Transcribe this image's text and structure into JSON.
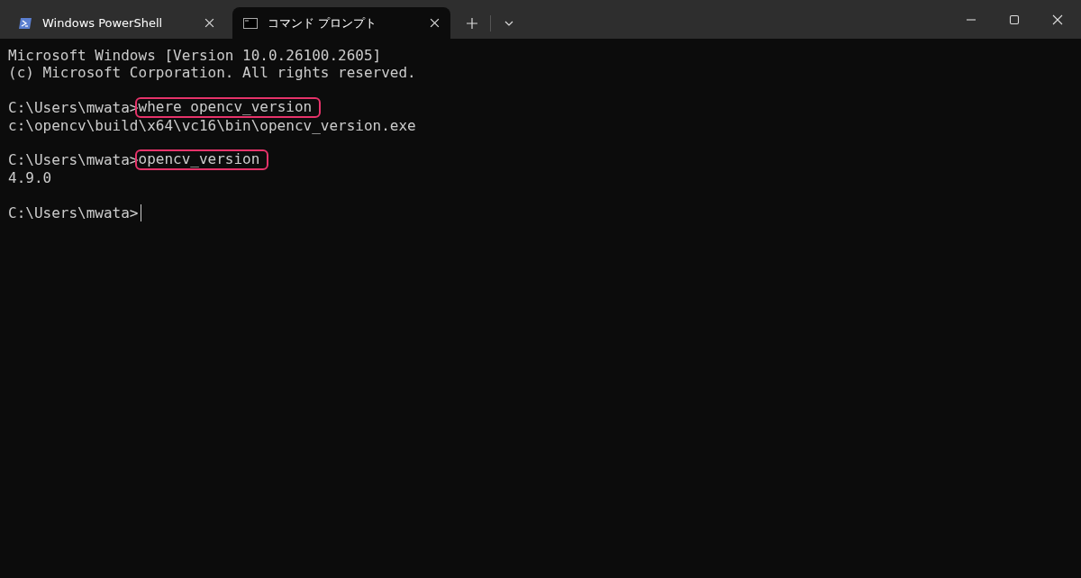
{
  "tabs": [
    {
      "label": "Windows PowerShell",
      "kind": "powershell",
      "selected": false
    },
    {
      "label": "コマンド プロンプト",
      "kind": "cmd",
      "selected": true
    }
  ],
  "terminal": {
    "lines": [
      {
        "kind": "output",
        "text": "Microsoft Windows [Version 10.0.26100.2605]"
      },
      {
        "kind": "output",
        "text": "(c) Microsoft Corporation. All rights reserved."
      },
      {
        "kind": "blank"
      },
      {
        "kind": "prompt",
        "prompt": "C:\\Users\\mwata>",
        "command": "where opencv_version",
        "highlighted": true
      },
      {
        "kind": "output",
        "text": "c:\\opencv\\build\\x64\\vc16\\bin\\opencv_version.exe"
      },
      {
        "kind": "blank"
      },
      {
        "kind": "prompt",
        "prompt": "C:\\Users\\mwata>",
        "command": "opencv_version",
        "highlighted": true
      },
      {
        "kind": "output",
        "text": "4.9.0"
      },
      {
        "kind": "blank"
      },
      {
        "kind": "prompt",
        "prompt": "C:\\Users\\mwata>",
        "cursor": true
      }
    ]
  }
}
